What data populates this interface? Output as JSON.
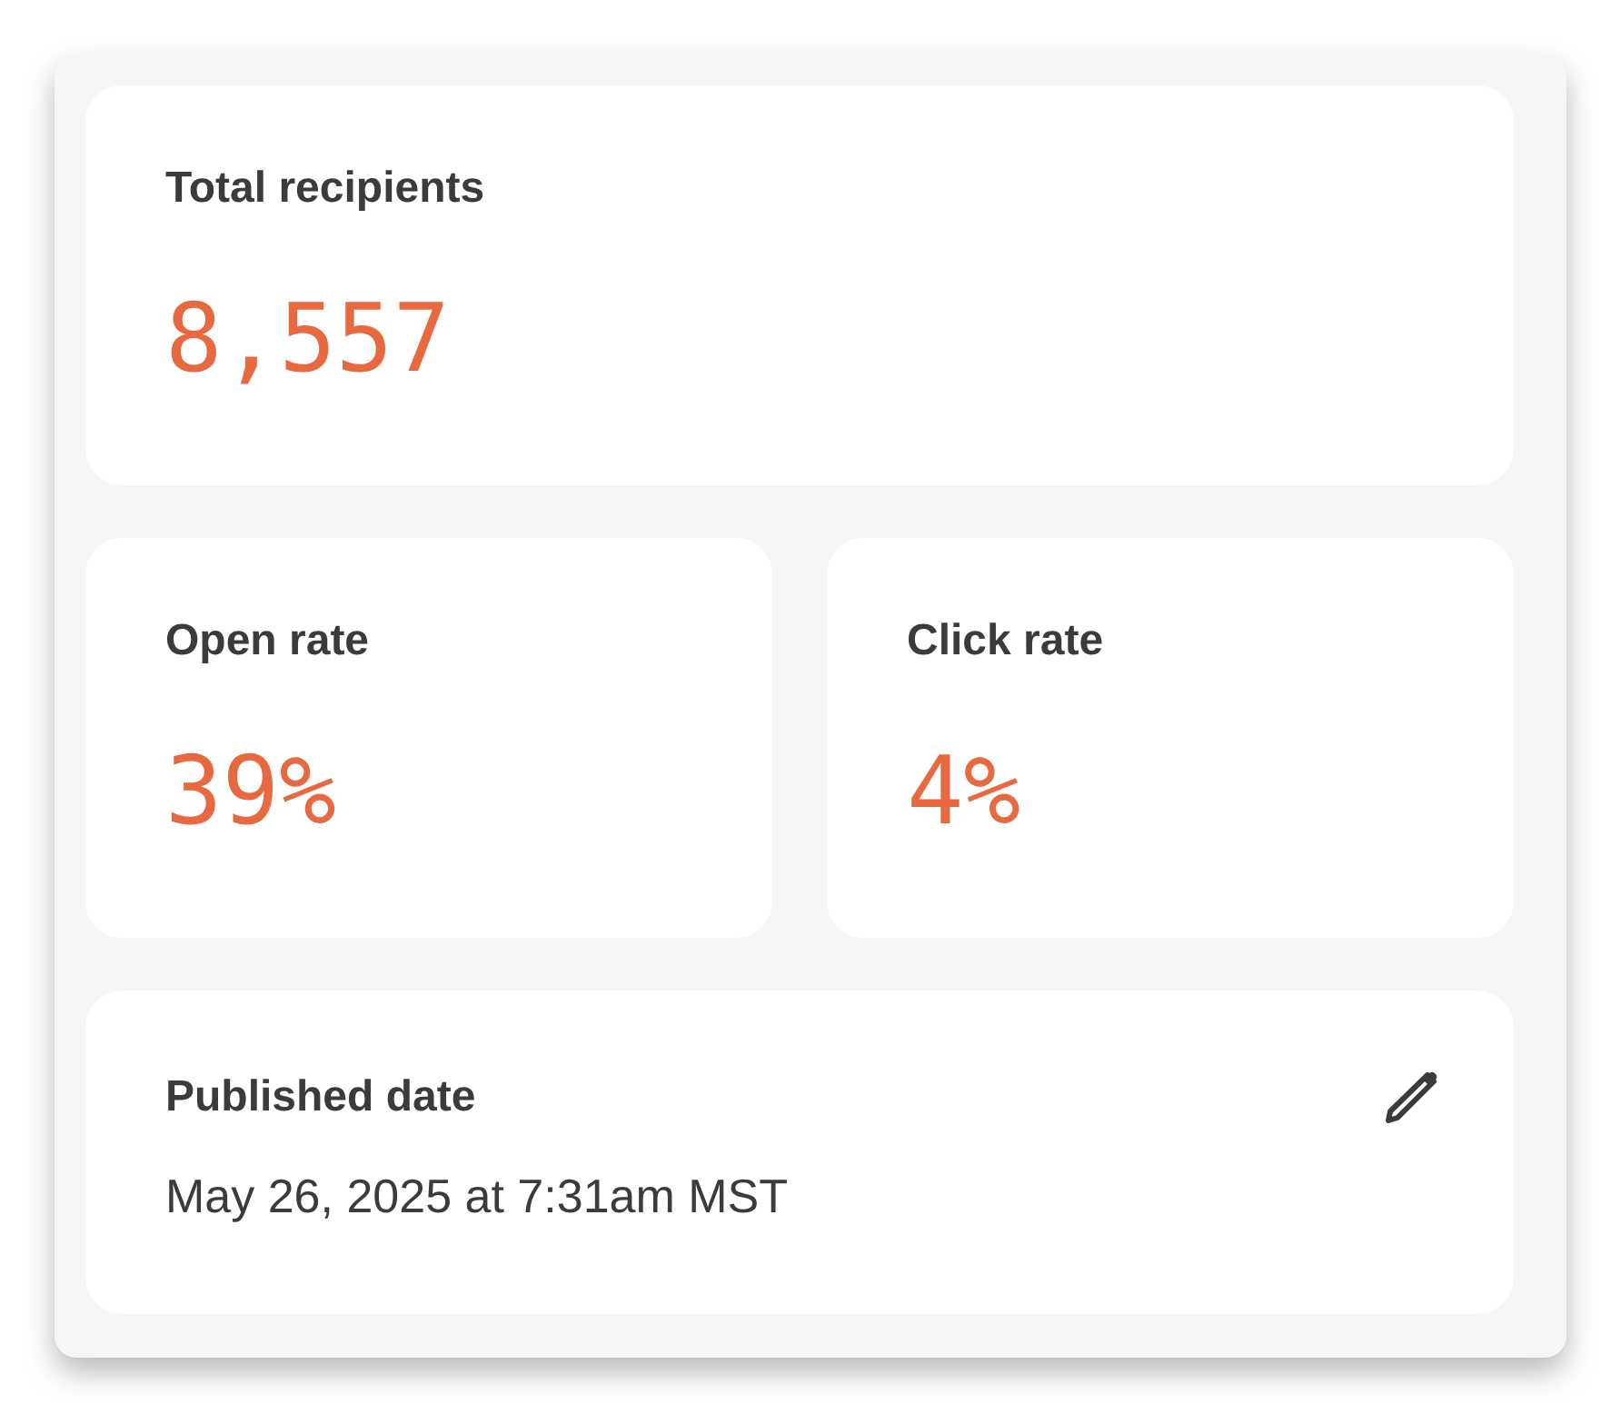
{
  "stats": [
    {
      "kind": "wide",
      "label": "Total recipients",
      "value": "8,557"
    },
    {
      "kind": "half",
      "label": "Open rate",
      "value": "39%"
    },
    {
      "kind": "half",
      "label": "Click rate",
      "value": "4%"
    }
  ],
  "published": {
    "label": "Published date",
    "value": "May 26, 2025 at 7:31am MST"
  }
}
